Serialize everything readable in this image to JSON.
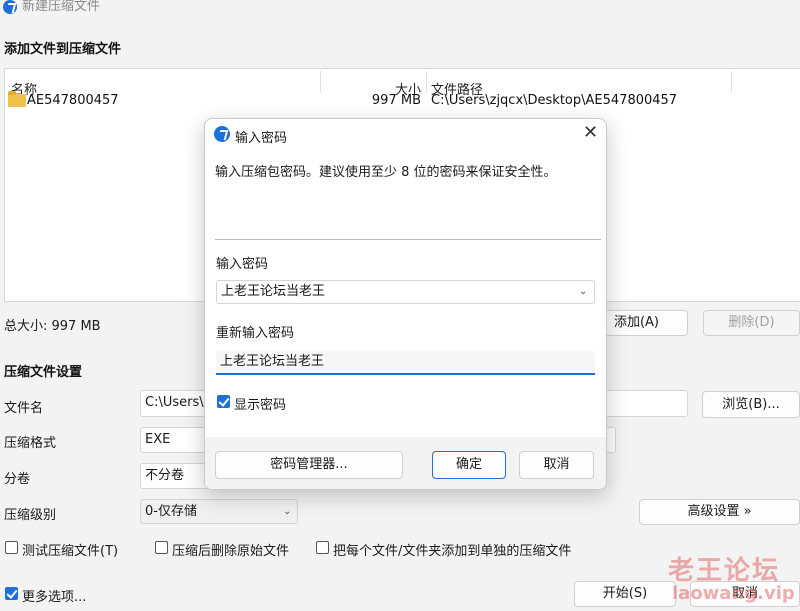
{
  "window": {
    "title": "新建压缩文件"
  },
  "add_files": {
    "section_title": "添加文件到压缩文件",
    "columns": {
      "name": "名称",
      "size": "大小",
      "path": "文件路径"
    },
    "rows": [
      {
        "name": "AE547800457",
        "size": "997 MB",
        "path": "C:\\Users\\zjqcx\\Desktop\\AE547800457"
      }
    ],
    "total_size": "总大小: 997 MB",
    "add_button": "添加(A)",
    "delete_button": "删除(D)"
  },
  "settings": {
    "section_title": "压缩文件设置",
    "filename_label": "文件名",
    "filename_value": "C:\\Users\\",
    "browse_button": "浏览(B)...",
    "format_label": "压缩格式",
    "format_value": "EXE",
    "split_label": "分卷",
    "split_value": "不分卷",
    "level_label": "压缩级别",
    "level_value": "0-仅存储",
    "advanced_button": "高级设置 »",
    "test_checkbox": "测试压缩文件(T)",
    "delete_after_checkbox": "压缩后删除原始文件",
    "separate_checkbox": "把每个文件/文件夹添加到单独的压缩文件",
    "more_options": "更多选项...",
    "start_button": "开始(S)",
    "cancel_button": "取消"
  },
  "dialog": {
    "title": "输入密码",
    "description": "输入压缩包密码。建议使用至少 8 位的密码来保证安全性。",
    "password_label": "输入密码",
    "password_value": "上老王论坛当老王",
    "confirm_label": "重新输入密码",
    "confirm_value": "上老王论坛当老王",
    "show_password": "显示密码",
    "manager_button": "密码管理器...",
    "ok_button": "确定",
    "cancel_button": "取消"
  },
  "watermark": {
    "line1": "老王论坛",
    "line2": "laowang.vip"
  },
  "colors": {
    "accent": "#1f6fd6",
    "watermark": "#e36a6a"
  }
}
